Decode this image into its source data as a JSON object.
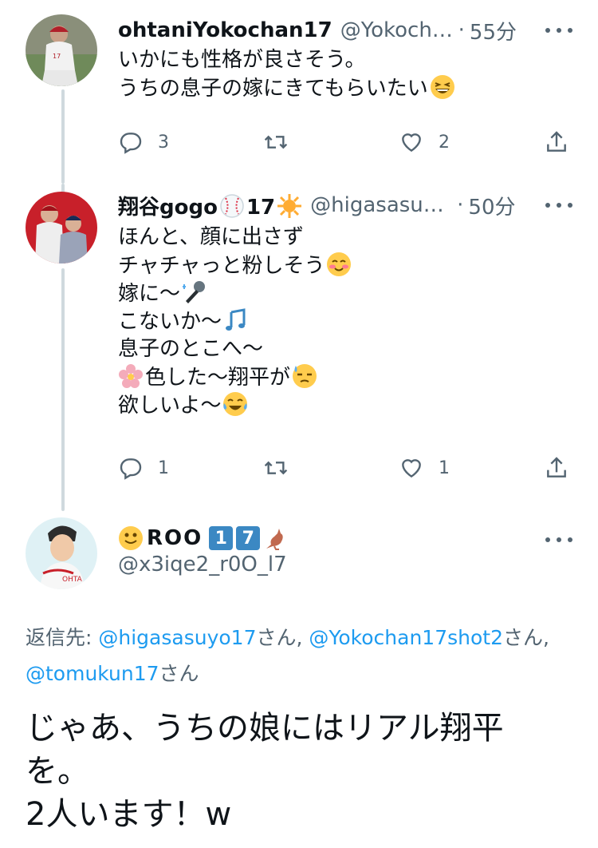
{
  "tweets": [
    {
      "name": "ohtaniYokochan17",
      "handle": "@Yokocha...",
      "time": "55分",
      "lines": [
        "いかにも性格が良さそう。",
        "うちの息子の嫁にきてもらいたい"
      ],
      "replies": "3",
      "retweets": "",
      "likes": "2"
    },
    {
      "name": "翔谷gogo",
      "name_suffix": "17",
      "handle": "@higasasuy...",
      "time": "50分",
      "lines": [
        "ほんと、顔に出さず",
        "チャチャっと粉しそう",
        "嫁に〜",
        "こないか〜",
        "息子のとこへ〜",
        "色した〜翔平が",
        "欲しいよ〜"
      ],
      "replies": "1",
      "retweets": "",
      "likes": "1"
    }
  ],
  "main_tweet": {
    "name_prefix": "ROO",
    "badge_1": "1",
    "badge_2": "7",
    "handle": "@x3iqe2_r0O_l7",
    "reply_label": "返信先: ",
    "mentions": [
      "@higasasuyo17",
      "@Yokochan17shot2",
      "@tomukun17"
    ],
    "mention_suffix": "さん",
    "separator": ", ",
    "text_lines": [
      "じゃあ、うちの娘にはリアル翔平",
      "を。",
      "2人います！w"
    ]
  },
  "icons": [
    "reply-icon",
    "retweet-icon",
    "like-icon",
    "share-icon",
    "more-icon"
  ],
  "colors": {
    "text": "#0f1419",
    "secondary": "#536471",
    "accent": "#1d9bf0",
    "thread": "#cfd9de"
  }
}
